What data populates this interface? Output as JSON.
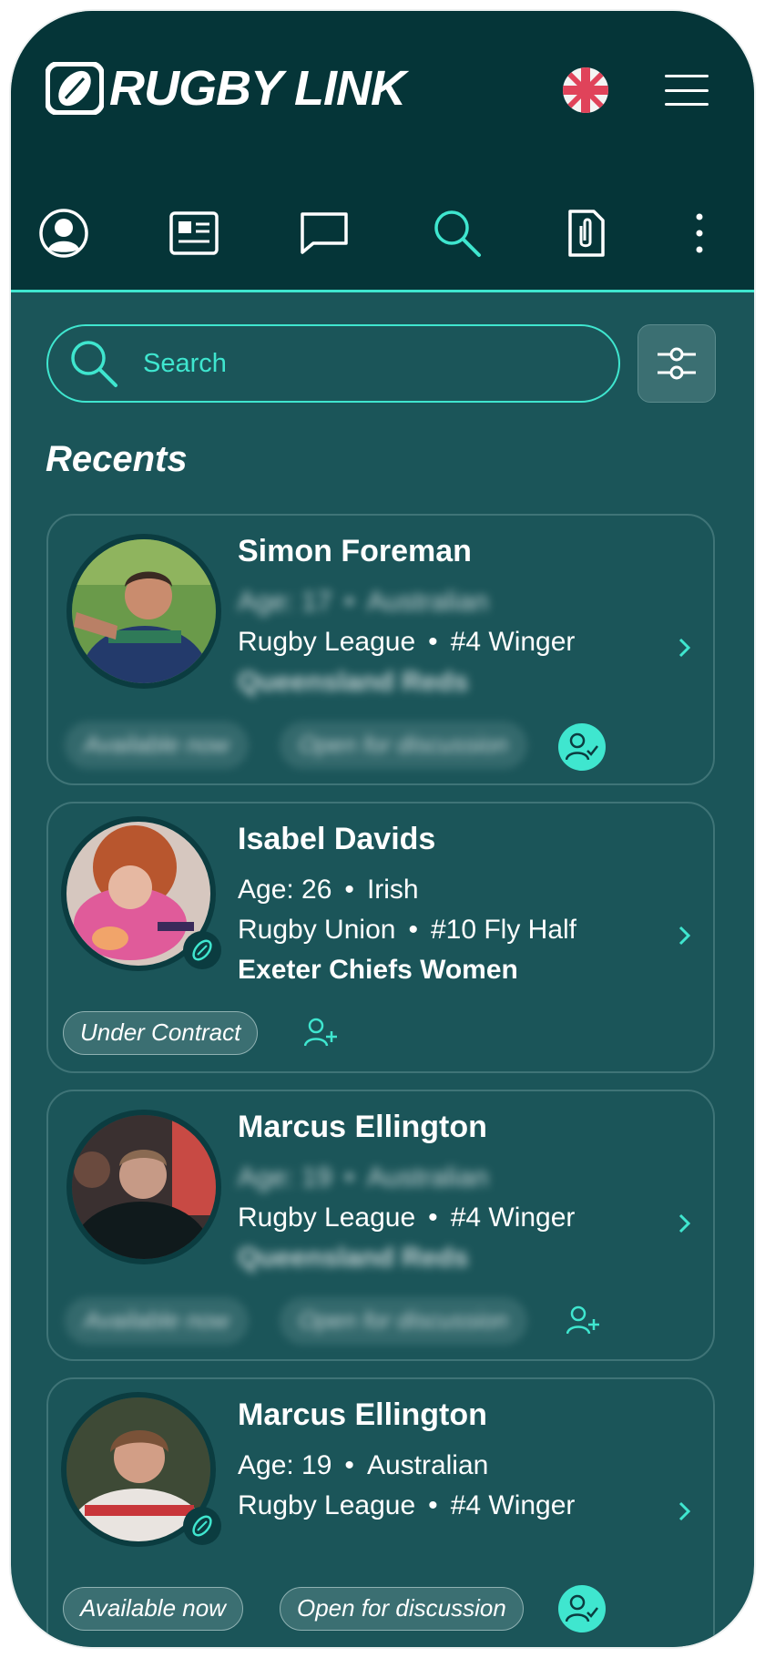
{
  "app": {
    "name": "RUGBY LINK"
  },
  "header": {
    "language_flag": "uk-flag-icon",
    "menu": "hamburger-menu-icon"
  },
  "nav": {
    "items": [
      "profile-icon",
      "news-icon",
      "messages-icon",
      "search-icon",
      "documents-icon",
      "more-icon"
    ],
    "active": "search-icon"
  },
  "search": {
    "placeholder": "Search"
  },
  "section": {
    "title": "Recents"
  },
  "colors": {
    "accent": "#3fe6cf",
    "background": "#1b5559",
    "header": "#053538"
  },
  "recents": [
    {
      "name": "Simon Foreman",
      "age_line": "Age: 17",
      "nationality": "Australian",
      "code": "Rugby League",
      "position": "#4 Winger",
      "team": "Queensland Reds",
      "tags": [
        "Available now",
        "Open for discussion"
      ],
      "details_blurred": true,
      "following": true
    },
    {
      "name": "Isabel Davids",
      "age_line": "Age: 26",
      "nationality": "Irish",
      "code": "Rugby Union",
      "position": "#10 Fly Half",
      "team": "Exeter Chiefs Women",
      "tags": [
        "Under Contract"
      ],
      "details_blurred": false,
      "following": false,
      "verified": true
    },
    {
      "name": "Marcus Ellington",
      "age_line": "Age: 19",
      "nationality": "Australian",
      "code": "Rugby League",
      "position": "#4 Winger",
      "team": "Queensland Reds",
      "tags": [
        "Available now",
        "Open for discussion"
      ],
      "details_blurred": true,
      "following": false
    },
    {
      "name": "Marcus Ellington",
      "age_line": "Age: 19",
      "nationality": "Australian",
      "code": "Rugby League",
      "position": "#4 Winger",
      "tags": [
        "Available now",
        "Open for discussion"
      ],
      "details_blurred": false,
      "following": true,
      "verified": true
    }
  ]
}
